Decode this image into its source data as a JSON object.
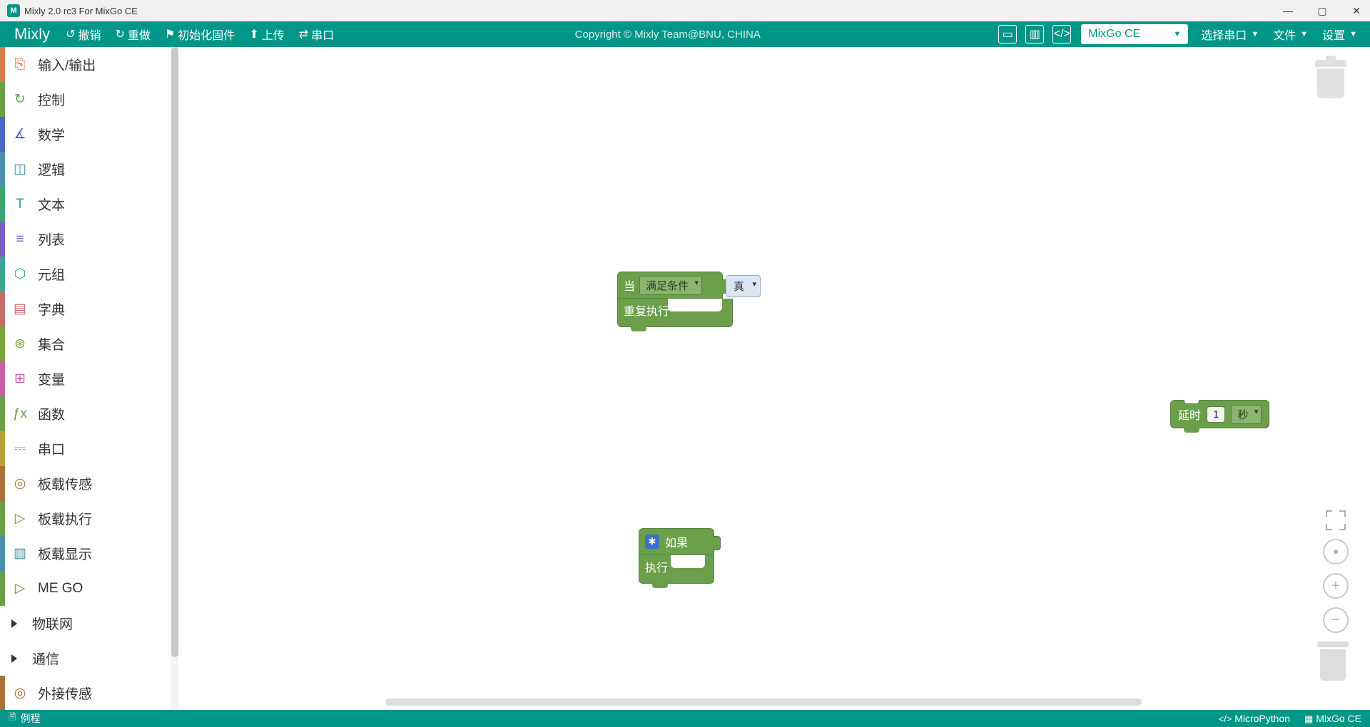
{
  "title": "Mixly 2.0 rc3 For MixGo CE",
  "brand": "Mixly",
  "menu": {
    "undo": "撤销",
    "redo": "重做",
    "init": "初始化固件",
    "upload": "上传",
    "serial": "串口"
  },
  "copyright": "Copyright © Mixly Team@BNU, CHINA",
  "board_selected": "MixGo CE",
  "port_select": "选择串口",
  "file_menu": "文件",
  "settings_menu": "设置",
  "categories": [
    {
      "label": "输入/输出",
      "bar": "#d77b4a",
      "icon": "⎘",
      "iconColor": "#d77b4a"
    },
    {
      "label": "控制",
      "bar": "#6b9f4a",
      "icon": "↻",
      "iconColor": "#6b9f4a"
    },
    {
      "label": "数学",
      "bar": "#4a66c7",
      "icon": "∡",
      "iconColor": "#4a66c7"
    },
    {
      "label": "逻辑",
      "bar": "#4a8fa6",
      "icon": "◫",
      "iconColor": "#4a8fa6"
    },
    {
      "label": "文本",
      "bar": "#3aa66f",
      "icon": "T",
      "iconColor": "#3aa66f"
    },
    {
      "label": "列表",
      "bar": "#7a5fc7",
      "icon": "≡",
      "iconColor": "#7a5fc7"
    },
    {
      "label": "元组",
      "bar": "#3aa690",
      "icon": "⬡",
      "iconColor": "#3aa690"
    },
    {
      "label": "字典",
      "bar": "#c76a6a",
      "icon": "▤",
      "iconColor": "#c76a6a"
    },
    {
      "label": "集合",
      "bar": "#7aa63a",
      "icon": "⊛",
      "iconColor": "#7aa63a"
    },
    {
      "label": "变量",
      "bar": "#c75fa6",
      "icon": "⊞",
      "iconColor": "#c75fa6"
    },
    {
      "label": "函数",
      "bar": "#6b9f4a",
      "icon": "ƒx",
      "iconColor": "#6b9f4a"
    },
    {
      "label": "串口",
      "bar": "#b8a23a",
      "icon": "⎓",
      "iconColor": "#b8a23a"
    },
    {
      "label": "板载传感",
      "bar": "#a6743a",
      "icon": "◎",
      "iconColor": "#a6743a"
    },
    {
      "label": "板载执行",
      "bar": "#6b9f4a",
      "icon": "▷",
      "iconColor": "#6b9f4a"
    },
    {
      "label": "板载显示",
      "bar": "#4a8fa6",
      "icon": "▥",
      "iconColor": "#4a8fa6"
    },
    {
      "label": "ME GO",
      "bar": "#6b9f4a",
      "icon": "▷",
      "iconColor": "#6b9f4a"
    },
    {
      "label": "物联网",
      "bar": "",
      "icon": "tri",
      "iconColor": "#333"
    },
    {
      "label": "通信",
      "bar": "",
      "icon": "tri",
      "iconColor": "#333"
    },
    {
      "label": "外接传感",
      "bar": "#a6743a",
      "icon": "◎",
      "iconColor": "#a6743a"
    }
  ],
  "blocks": {
    "while": {
      "when": "当",
      "cond": "满足条件",
      "repeat": "重复执行",
      "true": "真"
    },
    "if": {
      "if": "如果",
      "do": "执行"
    },
    "delay": {
      "label": "延时",
      "value": "1",
      "unit": "秒"
    }
  },
  "status": {
    "example": "例程",
    "lang": "MicroPython",
    "board": "MixGo CE"
  }
}
